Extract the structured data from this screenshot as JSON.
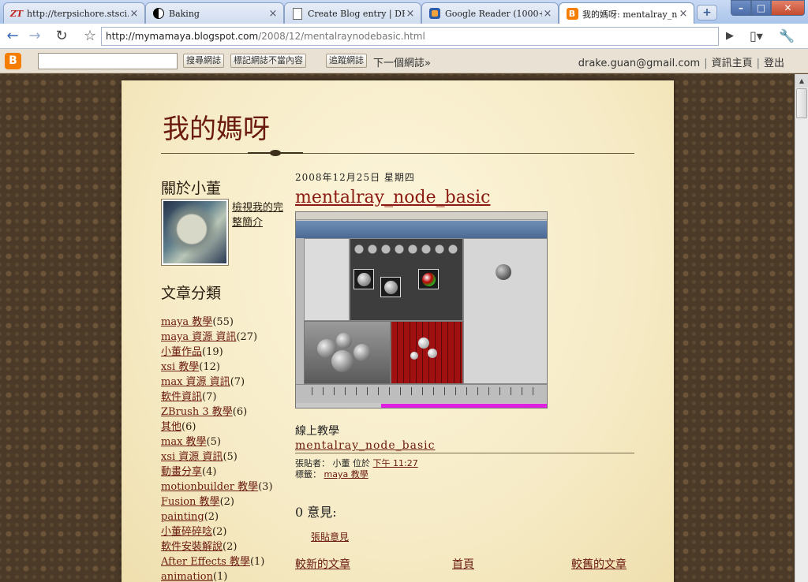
{
  "browser": {
    "tabs": [
      {
        "label": "http://terpsichore.stsci.ed...",
        "icon": "zt-icon",
        "active": false
      },
      {
        "label": "Baking",
        "icon": "yin-yang-icon",
        "active": false
      },
      {
        "label": "Create Blog entry | DR...",
        "icon": "document-icon",
        "active": false
      },
      {
        "label": "Google Reader (1000+)",
        "icon": "rss-icon",
        "active": false
      },
      {
        "label": "我的媽呀: mentalray_n...",
        "icon": "blogger-icon",
        "active": true
      }
    ],
    "url_host": "http://mymamaya.blogspot.com",
    "url_path": "/2008/12/mentalraynodebasic.html"
  },
  "navbar": {
    "search_button": "搜尋網誌",
    "flag_button": "標記網誌不當內容",
    "follow_button": "追蹤網誌",
    "next_blog": "下一個網誌»",
    "user_email": "drake.guan@gmail.com",
    "dashboard": "資訊主頁",
    "sign_out": "登出"
  },
  "blog": {
    "title": "我的媽呀",
    "about_heading": "關於小董",
    "profile_link": "檢視我的完整簡介",
    "labels_heading": "文章分類",
    "labels": [
      {
        "name": "maya 教學",
        "count": "(55)"
      },
      {
        "name": "maya 資源 資訊",
        "count": "(27)"
      },
      {
        "name": "小董作品",
        "count": "(19)"
      },
      {
        "name": "xsi 教學",
        "count": "(12)"
      },
      {
        "name": "max 資源 資訊",
        "count": "(7)"
      },
      {
        "name": "軟件資訊",
        "count": "(7)"
      },
      {
        "name": "ZBrush 3 教學",
        "count": "(6)"
      },
      {
        "name": "其他",
        "count": "(6)"
      },
      {
        "name": "max 教學",
        "count": "(5)"
      },
      {
        "name": "xsi 資源 資訊",
        "count": "(5)"
      },
      {
        "name": "動畫分享",
        "count": "(4)"
      },
      {
        "name": "motionbuilder 教學",
        "count": "(3)"
      },
      {
        "name": "Fusion 教學",
        "count": "(2)"
      },
      {
        "name": "painting",
        "count": "(2)"
      },
      {
        "name": "小董碎碎唸",
        "count": "(2)"
      },
      {
        "name": "軟件安裝解說",
        "count": "(2)"
      },
      {
        "name": "After Effects 教學",
        "count": "(1)"
      },
      {
        "name": "animation",
        "count": "(1)"
      }
    ]
  },
  "post": {
    "date": "2008年12月25日 星期四",
    "title": "mentalray_node_basic",
    "body_text": "線上教學",
    "body_link": "mentalray_node_basic",
    "meta_posted_by": "張貼者： 小董 位於",
    "meta_time": "下午 11:27",
    "meta_labels_prefix": "標籤：",
    "meta_label": "maya 教學",
    "comments_heading": "0 意見:",
    "post_comment_link": "張貼意見",
    "pager_newer": "較新的文章",
    "pager_home": "首頁",
    "pager_older": "較舊的文章"
  }
}
